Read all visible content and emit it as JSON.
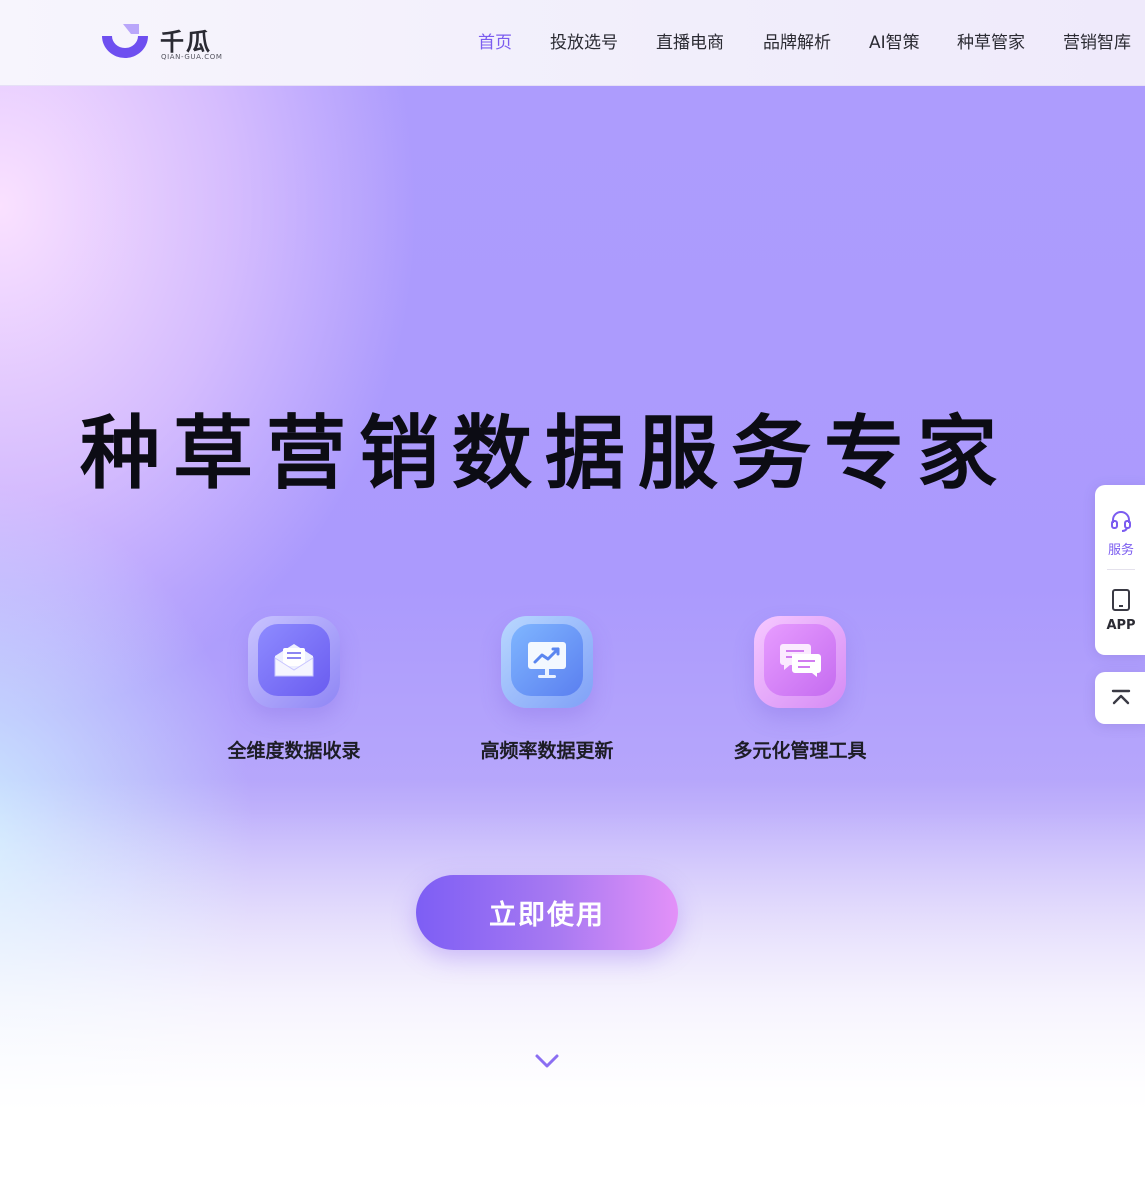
{
  "header": {
    "logo": {
      "name_cn": "千瓜",
      "name_en": "QIAN-GUA.COM"
    },
    "nav": [
      {
        "label": "首页",
        "active": true
      },
      {
        "label": "投放选号",
        "active": false
      },
      {
        "label": "直播电商",
        "active": false
      },
      {
        "label": "品牌解析",
        "active": false
      },
      {
        "label": "AI智策",
        "active": false
      },
      {
        "label": "种草管家",
        "active": false
      },
      {
        "label": "营销智库",
        "active": false
      }
    ]
  },
  "hero": {
    "title": "种草营销数据服务专家",
    "features": [
      {
        "label": "全维度数据收录",
        "icon": "mail-icon"
      },
      {
        "label": "高频率数据更新",
        "icon": "trend-chart-icon"
      },
      {
        "label": "多元化管理工具",
        "icon": "chat-icon"
      }
    ],
    "cta_label": "立即使用"
  },
  "side_panel": {
    "service_label": "服务",
    "app_label": "APP"
  },
  "colors": {
    "accent": "#7b5cf0",
    "hero_purple": "#ab9afd",
    "title_text": "#0c0c14",
    "cta_start": "#7d5ef4",
    "cta_end": "#e391f8"
  }
}
